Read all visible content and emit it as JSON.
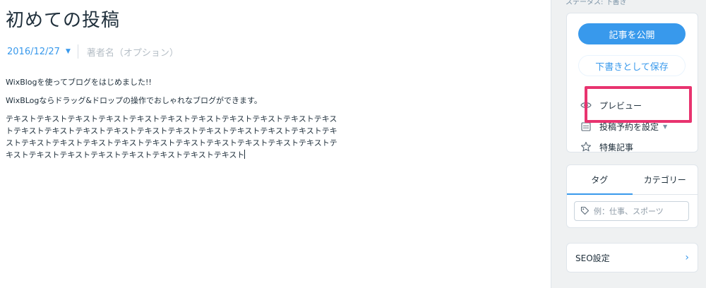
{
  "post": {
    "title": "初めての投稿",
    "date": "2016/12/27",
    "author_placeholder": "著者名（オプション）",
    "paragraphs": [
      "WixBlogを使ってブログをはじめました!!",
      "WixBLogならドラッグ&ドロップの操作でおしゃれなブログができます。",
      "テキストテキストテキストテキストテキストテキストテキストテキストテキストテキストテキストテキストテキストテキストテキストテキストテキストテキストテキストテキストテキストテキストテキストテキストテキストテキストテキストテキストテキストテキストテキストテキストテキストテキストテキストテキストテキストテキストテキストテキスト"
    ]
  },
  "sidebar": {
    "status_text": "ステータス: 下書き",
    "publish_label": "記事を公開",
    "draft_label": "下書きとして保存",
    "preview_label": "プレビュー",
    "schedule_label": "投稿予約を設定",
    "featured_label": "特集記事",
    "tabs": [
      {
        "label": "タグ",
        "active": true
      },
      {
        "label": "カテゴリー",
        "active": false
      }
    ],
    "tag_placeholder": "例：仕事、スポーツ",
    "seo_label": "SEO設定"
  },
  "colors": {
    "accent": "#3899ec",
    "highlight": "#e8336f",
    "panel_bg": "#eff1f2"
  }
}
